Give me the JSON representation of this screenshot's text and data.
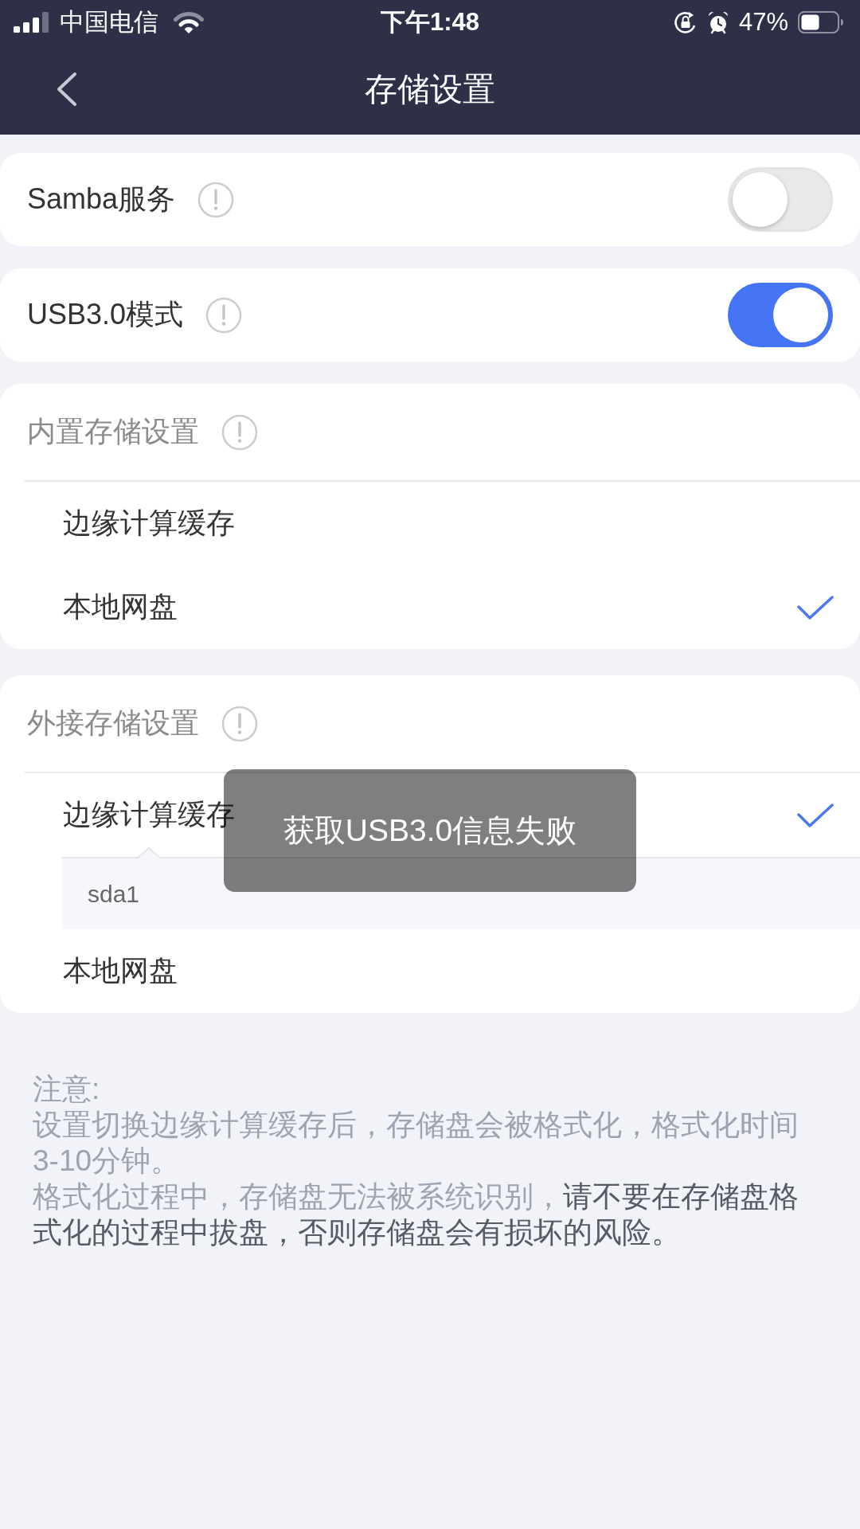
{
  "status_bar": {
    "carrier": "中国电信",
    "time": "下午1:48",
    "battery": "47%"
  },
  "nav_bar": {
    "title": "存储设置"
  },
  "toggle_rows": [
    {
      "label": "Samba服务",
      "on": false
    },
    {
      "label": "USB3.0模式",
      "on": true
    }
  ],
  "sections": [
    {
      "title": "内置存储设置",
      "options": [
        {
          "label": "边缘计算缓存",
          "selected": false
        },
        {
          "label": "本地网盘",
          "selected": true
        }
      ]
    },
    {
      "title": "外接存储设置",
      "options": [
        {
          "label": "边缘计算缓存",
          "selected": true,
          "devices": [
            "sda1"
          ]
        },
        {
          "label": "本地网盘",
          "selected": false
        }
      ]
    }
  ],
  "toast": {
    "message": "获取USB3.0信息失败"
  },
  "note": {
    "title": "注意:",
    "paragraphs": [
      [
        {
          "text": "设置切换边缘计算缓存后，存储盘会被格式化，格式化时间3-10分钟。",
          "emphasis": false
        }
      ],
      [
        {
          "text": "格式化过程中，存储盘无法被系统识别，",
          "emphasis": false
        },
        {
          "text": "请不要在存储盘格式化的过程中拔盘，否则存储盘会有损坏的风险。",
          "emphasis": true
        }
      ]
    ]
  }
}
